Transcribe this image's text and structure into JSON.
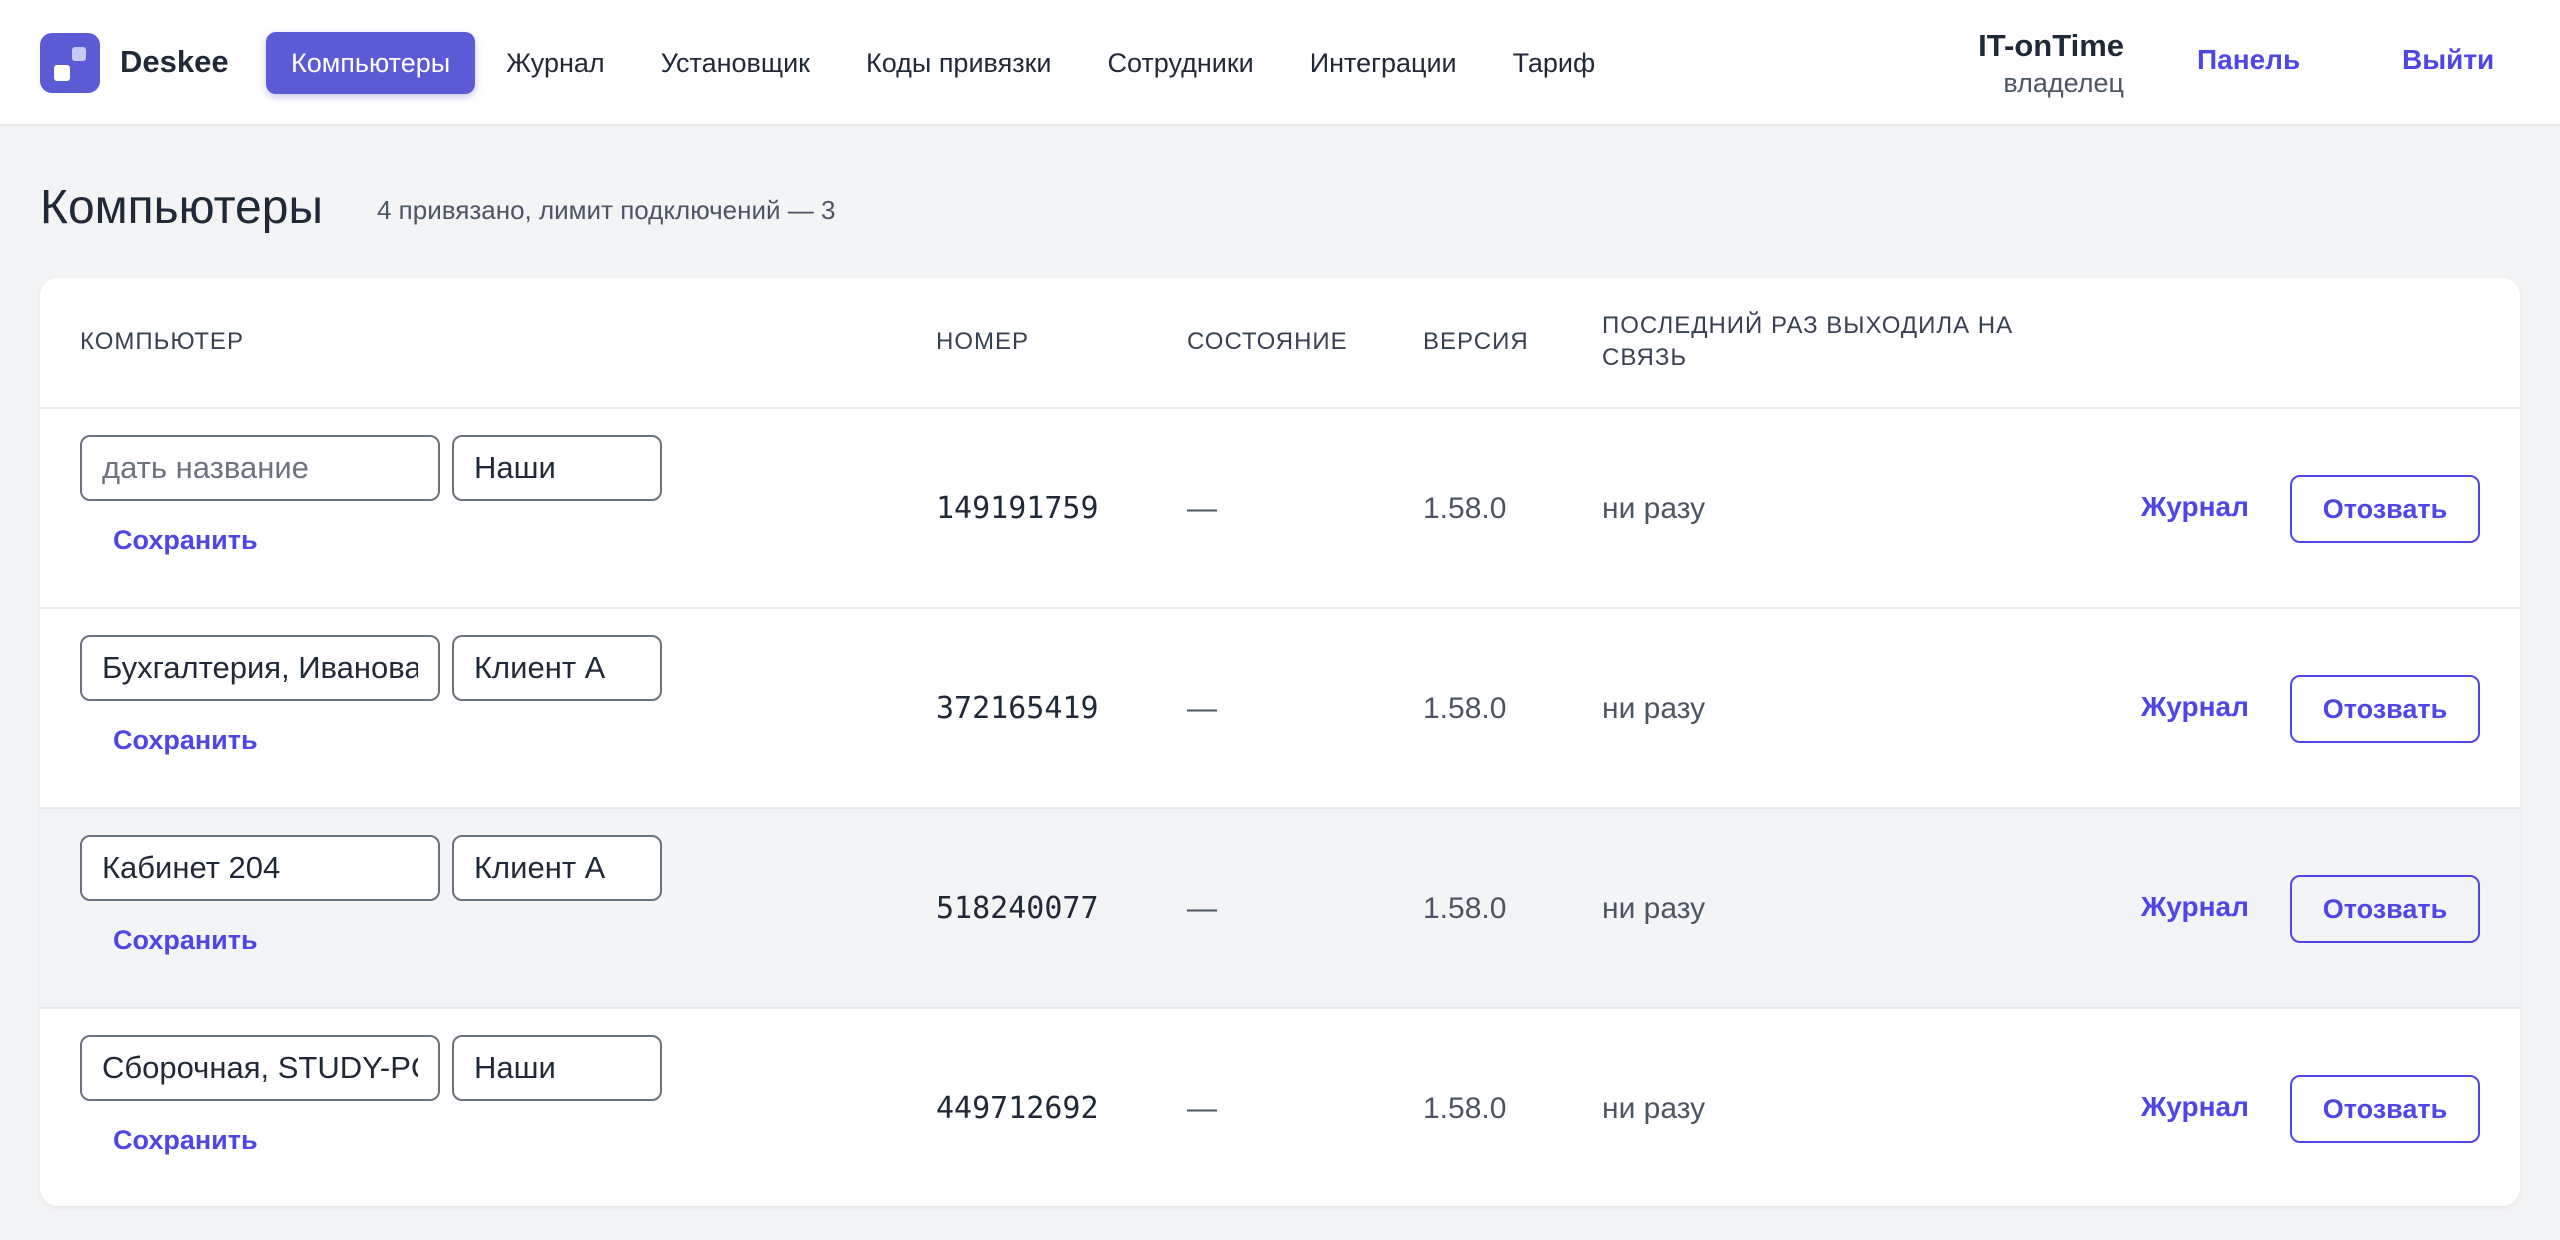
{
  "header": {
    "brand": "Deskee",
    "nav": [
      {
        "label": "Компьютеры",
        "active": true
      },
      {
        "label": "Журнал",
        "active": false
      },
      {
        "label": "Установщик",
        "active": false
      },
      {
        "label": "Коды привязки",
        "active": false
      },
      {
        "label": "Сотрудники",
        "active": false
      },
      {
        "label": "Интеграции",
        "active": false
      },
      {
        "label": "Тариф",
        "active": false
      }
    ],
    "org_name": "IT-onTime",
    "org_role": "владелец",
    "panel_label": "Панель",
    "logout_label": "Выйти"
  },
  "page": {
    "title": "Компьютеры",
    "subtitle": "4 привязано, лимит подключений — 3"
  },
  "table": {
    "columns": {
      "computer": "КОМПЬЮТЕР",
      "number": "НОМЕР",
      "state": "СОСТОЯНИЕ",
      "version": "ВЕРСИЯ",
      "last_seen": "ПОСЛЕДНИЙ РАЗ ВЫХОДИЛА НА СВЯЗЬ"
    },
    "name_placeholder": "дать название",
    "save_label": "Сохранить",
    "journal_label": "Журнал",
    "revoke_label": "Отозвать",
    "rows": [
      {
        "name": "",
        "group": "Наши",
        "number": "149191759",
        "state": "—",
        "version": "1.58.0",
        "last_seen": "ни разу"
      },
      {
        "name": "Бухгалтерия, Иванова",
        "group": "Клиент А",
        "number": "372165419",
        "state": "—",
        "version": "1.58.0",
        "last_seen": "ни разу"
      },
      {
        "name": "Кабинет 204",
        "group": "Клиент А",
        "number": "518240077",
        "state": "—",
        "version": "1.58.0",
        "last_seen": "ни разу"
      },
      {
        "name": "Сборочная, STUDY-PC",
        "group": "Наши",
        "number": "449712692",
        "state": "—",
        "version": "1.58.0",
        "last_seen": "ни разу"
      }
    ]
  },
  "colors": {
    "accent": "#5b5bd6",
    "link": "#4f46e5",
    "background": "#f3f4f6"
  }
}
